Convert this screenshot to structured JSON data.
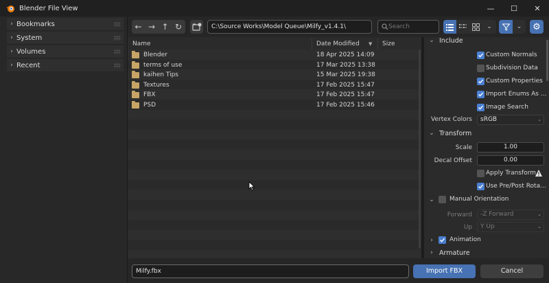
{
  "window": {
    "title": "Blender File View",
    "minimize": "—",
    "maximize": "☐",
    "close": "✕"
  },
  "sidebar": {
    "panels": [
      {
        "label": "Bookmarks"
      },
      {
        "label": "System"
      },
      {
        "label": "Volumes"
      },
      {
        "label": "Recent"
      }
    ]
  },
  "toolbar": {
    "back": "←",
    "forward": "→",
    "parent": "↑",
    "refresh": "↻",
    "path": "C:\\Source Works\\Model Queue\\Milfy_v1.4.1\\",
    "search_placeholder": "Search"
  },
  "filelist": {
    "columns": {
      "name": "Name",
      "date": "Date Modified",
      "size": "Size"
    },
    "files": [
      {
        "name": "Blender",
        "date": "18 Apr 2025 14:09"
      },
      {
        "name": "terms of use",
        "date": "17 Mar 2025 13:38"
      },
      {
        "name": "kaihen Tips",
        "date": "15 Mar 2025 19:38"
      },
      {
        "name": "Textures",
        "date": "17 Feb 2025 15:47"
      },
      {
        "name": "FBX",
        "date": "17 Feb 2025 15:47"
      },
      {
        "name": "PSD",
        "date": "17 Feb 2025 15:46"
      }
    ]
  },
  "options": {
    "include": {
      "label": "Include",
      "custom_normals": {
        "label": "Custom Normals",
        "checked": true
      },
      "subdivision_data": {
        "label": "Subdivision Data",
        "checked": false
      },
      "custom_properties": {
        "label": "Custom Properties",
        "checked": true
      },
      "import_enums": {
        "label": "Import Enums As ...",
        "checked": true
      },
      "image_search": {
        "label": "Image Search",
        "checked": true
      },
      "vertex_colors_label": "Vertex Colors",
      "vertex_colors_value": "sRGB"
    },
    "transform": {
      "label": "Transform",
      "scale_label": "Scale",
      "scale_value": "1.00",
      "decal_offset_label": "Decal Offset",
      "decal_offset_value": "0.00",
      "apply_transform": {
        "label": "Apply Transform",
        "checked": false
      },
      "use_prepost": {
        "label": "Use Pre/Post Rota...",
        "checked": true
      }
    },
    "manual_orientation": {
      "label": "Manual Orientation",
      "checked": false,
      "forward_label": "Forward",
      "forward_value": "-Z Forward",
      "up_label": "Up",
      "up_value": "Y Up"
    },
    "animation": {
      "label": "Animation",
      "checked": true
    },
    "armature": {
      "label": "Armature"
    }
  },
  "bottom": {
    "filename": "Milfy.fbx",
    "import_label": "Import FBX",
    "cancel_label": "Cancel"
  },
  "colors": {
    "accent": "#4772b3",
    "checkbox_on": "#4a7fd1",
    "folder": "#c7a465"
  }
}
